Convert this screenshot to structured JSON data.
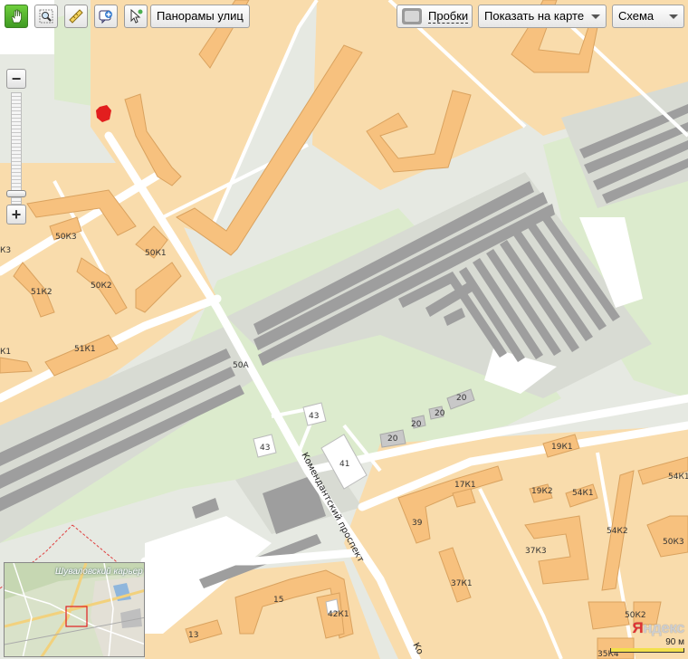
{
  "toolbar": {
    "tools": [
      {
        "name": "hand-tool",
        "active": true
      },
      {
        "name": "magnifier-tool",
        "active": false
      },
      {
        "name": "ruler-tool",
        "active": false
      },
      {
        "name": "add-point-tool",
        "active": false
      },
      {
        "name": "pointer-tool",
        "active": false
      }
    ],
    "panoramas_label": "Панорамы улиц",
    "traffic_label": "Пробки",
    "show_on_map_label": "Показать на карте",
    "map_type_label": "Схема"
  },
  "zoom": {
    "minus": "−",
    "plus": "+"
  },
  "map": {
    "street_name": "Комендантский проспект",
    "street_name_bottom": "Ко",
    "building_labels": [
      "50К3",
      "К3",
      "50К1",
      "51К2",
      "50К2",
      "51К1",
      "К1",
      "50А",
      "43",
      "43",
      "41",
      "20",
      "20",
      "20",
      "20",
      "19К1",
      "17К1",
      "19К2",
      "54К1",
      "54К1",
      "39",
      "50К3",
      "54К2",
      "37К3",
      "37К1",
      "15",
      "42К1",
      "13",
      "50К2",
      "35К4"
    ]
  },
  "minimap": {
    "label": "Шуваловский карьер"
  },
  "logo": {
    "text": "Яндекс",
    "first": "Я",
    "rest": "ндекс"
  },
  "scale": {
    "label": "90 м"
  },
  "colors": {
    "block": "#f9dcac",
    "building": "#f7c17e",
    "building_edge": "#d9a25f",
    "park": "#dcebcd",
    "industrial": "#d8dbd3",
    "rail": "#9a9a9a",
    "road": "#ffffff",
    "accent": "#e21e1e"
  }
}
